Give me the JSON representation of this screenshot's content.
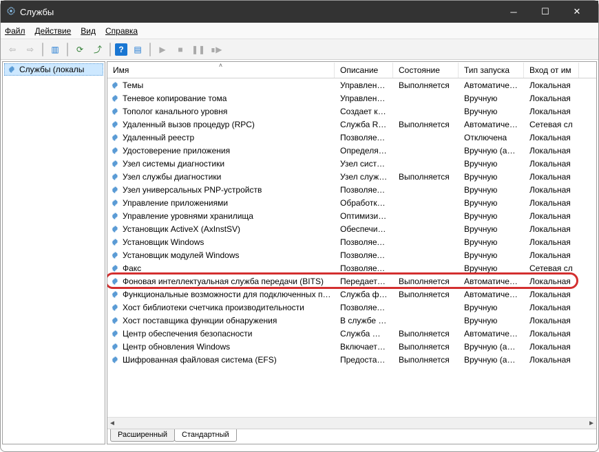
{
  "window": {
    "title": "Службы"
  },
  "menu": {
    "file": "Файл",
    "action": "Действие",
    "view": "Вид",
    "help": "Справка"
  },
  "sidebar": {
    "root": "Службы (локалы"
  },
  "columns": {
    "name": "Имя",
    "description": "Описание",
    "status": "Состояние",
    "startup": "Тип запуска",
    "logon": "Вход от им"
  },
  "col_widths": {
    "name": 330,
    "description": 85,
    "status": 95,
    "startup": 95,
    "logon": 80
  },
  "services": [
    {
      "name": "Темы",
      "desc": "Управлен…",
      "status": "Выполняется",
      "startup": "Автоматиче…",
      "logon": "Локальная"
    },
    {
      "name": "Теневое копирование тома",
      "desc": "Управлен…",
      "status": "",
      "startup": "Вручную",
      "logon": "Локальная"
    },
    {
      "name": "Тополог канального уровня",
      "desc": "Создает ка…",
      "status": "",
      "startup": "Вручную",
      "logon": "Локальная"
    },
    {
      "name": "Удаленный вызов процедур (RPC)",
      "desc": "Служба R…",
      "status": "Выполняется",
      "startup": "Автоматиче…",
      "logon": "Сетевая сл"
    },
    {
      "name": "Удаленный реестр",
      "desc": "Позволяет…",
      "status": "",
      "startup": "Отключена",
      "logon": "Локальная"
    },
    {
      "name": "Удостоверение приложения",
      "desc": "Определя…",
      "status": "",
      "startup": "Вручную (ак…",
      "logon": "Локальная"
    },
    {
      "name": "Узел системы диагностики",
      "desc": "Узел систе…",
      "status": "",
      "startup": "Вручную",
      "logon": "Локальная"
    },
    {
      "name": "Узел службы диагностики",
      "desc": "Узел служб…",
      "status": "Выполняется",
      "startup": "Вручную",
      "logon": "Локальная"
    },
    {
      "name": "Узел универсальных PNP-устройств",
      "desc": "Позволяет…",
      "status": "",
      "startup": "Вручную",
      "logon": "Локальная"
    },
    {
      "name": "Управление приложениями",
      "desc": "Обработк…",
      "status": "",
      "startup": "Вручную",
      "logon": "Локальная"
    },
    {
      "name": "Управление уровнями хранилища",
      "desc": "Оптимизи…",
      "status": "",
      "startup": "Вручную",
      "logon": "Локальная"
    },
    {
      "name": "Установщик ActiveX (AxInstSV)",
      "desc": "Обеспечи…",
      "status": "",
      "startup": "Вручную",
      "logon": "Локальная"
    },
    {
      "name": "Установщик Windows",
      "desc": "Позволяет…",
      "status": "",
      "startup": "Вручную",
      "logon": "Локальная"
    },
    {
      "name": "Установщик модулей Windows",
      "desc": "Позволяет…",
      "status": "",
      "startup": "Вручную",
      "logon": "Локальная"
    },
    {
      "name": "Факс",
      "desc": "Позволяет…",
      "status": "",
      "startup": "Вручную",
      "logon": "Сетевая сл"
    },
    {
      "name": "Фоновая интеллектуальная служба передачи (BITS)",
      "desc": "Передает …",
      "status": "Выполняется",
      "startup": "Автоматиче…",
      "logon": "Локальная",
      "highlight": true
    },
    {
      "name": "Функциональные возможности для подключенных п…",
      "desc": "Служба ф…",
      "status": "Выполняется",
      "startup": "Автоматиче…",
      "logon": "Локальная"
    },
    {
      "name": "Хост библиотеки счетчика производительности",
      "desc": "Позволяет…",
      "status": "",
      "startup": "Вручную",
      "logon": "Локальная"
    },
    {
      "name": "Хост поставщика функции обнаружения",
      "desc": "В службе …",
      "status": "",
      "startup": "Вручную",
      "logon": "Локальная"
    },
    {
      "name": "Центр обеспечения безопасности",
      "desc": "Служба W…",
      "status": "Выполняется",
      "startup": "Автоматиче…",
      "logon": "Локальная"
    },
    {
      "name": "Центр обновления Windows",
      "desc": "Включает …",
      "status": "Выполняется",
      "startup": "Вручную (ак…",
      "logon": "Локальная"
    },
    {
      "name": "Шифрованная файловая система (EFS)",
      "desc": "Предостав…",
      "status": "Выполняется",
      "startup": "Вручную (ак…",
      "logon": "Локальная"
    }
  ],
  "tabs": {
    "extended": "Расширенный",
    "standard": "Стандартный"
  }
}
